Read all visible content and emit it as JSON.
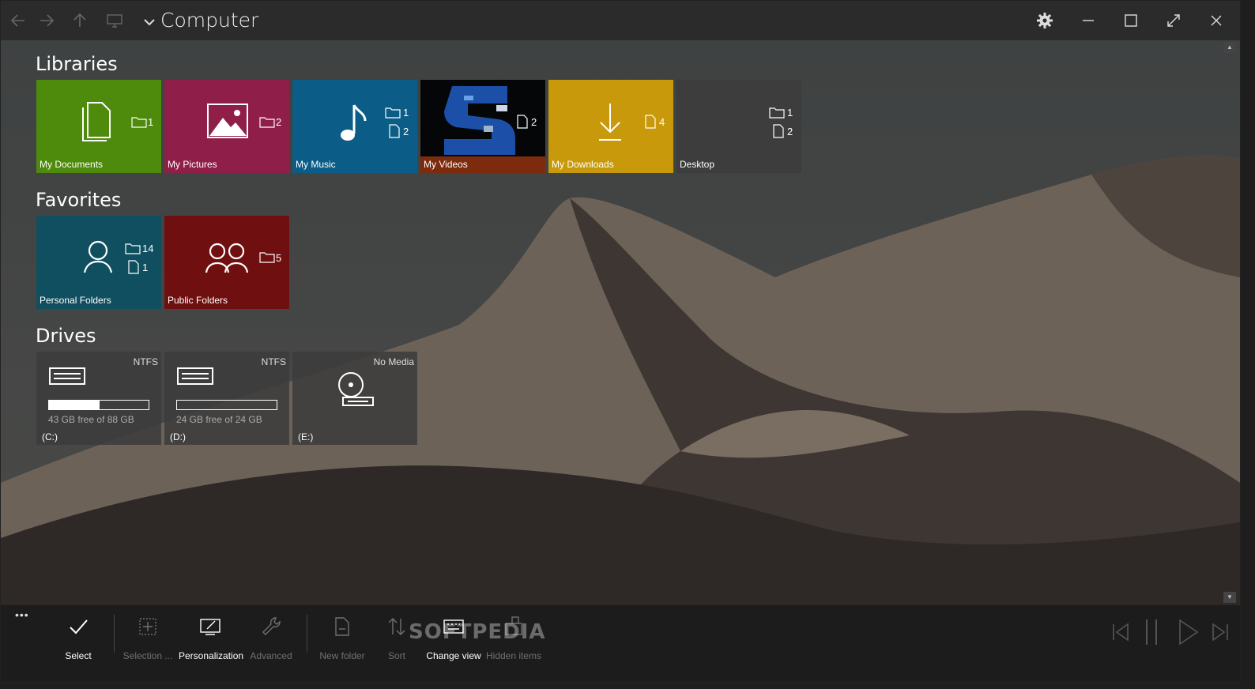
{
  "window": {
    "title": "Computer"
  },
  "colors": {
    "documents": "#4e8a0c",
    "pictures": "#8f1f48",
    "music": "#0b5c86",
    "downloads": "#c89a0b",
    "desktop": "#3d3d3d",
    "personal": "#0f4f5f",
    "public": "#700f0f"
  },
  "sections": {
    "libraries": "Libraries",
    "favorites": "Favorites",
    "drives": "Drives"
  },
  "libraries": [
    {
      "label": "My Documents",
      "folders": "1"
    },
    {
      "label": "My Pictures",
      "folders": "2"
    },
    {
      "label": "My Music",
      "folders": "1",
      "files": "2"
    },
    {
      "label": "My Videos",
      "files": "2"
    },
    {
      "label": "My Downloads",
      "files": "4"
    },
    {
      "label": "Desktop",
      "folders": "1",
      "files": "2"
    }
  ],
  "favorites": [
    {
      "label": "Personal Folders",
      "folders": "14",
      "files": "1"
    },
    {
      "label": "Public Folders",
      "folders": "5"
    }
  ],
  "drives": [
    {
      "name": "(C:)",
      "fs": "NTFS",
      "free": "43 GB free of 88 GB",
      "used_fraction": 0.51
    },
    {
      "name": "(D:)",
      "fs": "NTFS",
      "free": "24 GB free of 24 GB",
      "used_fraction": 0.0
    },
    {
      "name": "(E:)",
      "fs": "No Media"
    }
  ],
  "toolbar": {
    "more": "•••",
    "select": "Select",
    "selection": "Selection ...",
    "personalization": "Personalization",
    "advanced": "Advanced",
    "new_folder": "New folder",
    "sort": "Sort",
    "change_view": "Change view",
    "hidden_items": "Hidden items"
  },
  "watermark": "SOFTPEDIA"
}
